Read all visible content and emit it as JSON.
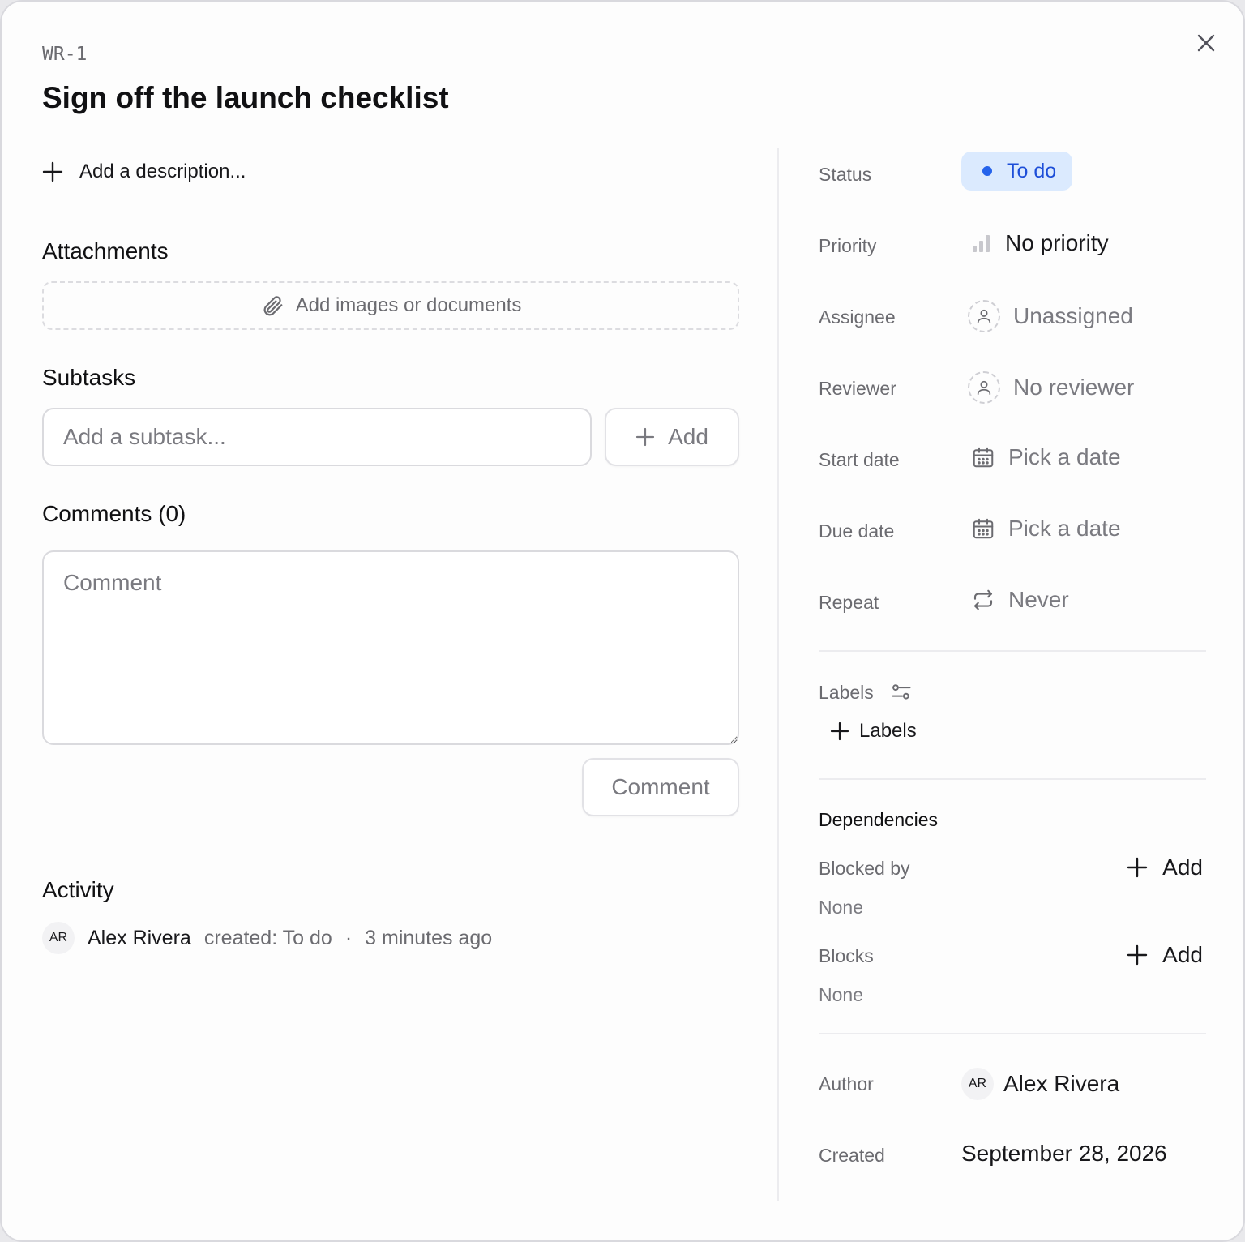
{
  "task": {
    "id": "WR-1",
    "title": "Sign off the launch checklist"
  },
  "description": {
    "add_label": "Add a description..."
  },
  "attachments": {
    "heading": "Attachments",
    "drop_label": "Add images or documents"
  },
  "subtasks": {
    "heading": "Subtasks",
    "input_placeholder": "Add a subtask...",
    "add_label": "Add"
  },
  "comments": {
    "heading": "Comments (0)",
    "placeholder": "Comment",
    "submit_label": "Comment"
  },
  "activity": {
    "heading": "Activity",
    "items": [
      {
        "initials": "AR",
        "user": "Alex Rivera",
        "action": "created: To do",
        "separator": "·",
        "time": "3 minutes ago"
      }
    ]
  },
  "properties": {
    "status": {
      "label": "Status",
      "value": "To do",
      "color": "#2563eb"
    },
    "priority": {
      "label": "Priority",
      "value": "No priority"
    },
    "assignee": {
      "label": "Assignee",
      "value": "Unassigned"
    },
    "reviewer": {
      "label": "Reviewer",
      "value": "No reviewer"
    },
    "start_date": {
      "label": "Start date",
      "value": "Pick a date"
    },
    "due_date": {
      "label": "Due date",
      "value": "Pick a date"
    },
    "repeat": {
      "label": "Repeat",
      "value": "Never"
    }
  },
  "labels": {
    "heading": "Labels",
    "add_label": "Labels"
  },
  "dependencies": {
    "heading": "Dependencies",
    "blocked_by": {
      "label": "Blocked by",
      "add_label": "Add",
      "value": "None"
    },
    "blocks": {
      "label": "Blocks",
      "add_label": "Add",
      "value": "None"
    }
  },
  "meta": {
    "author": {
      "label": "Author",
      "initials": "AR",
      "name": "Alex Rivera"
    },
    "created": {
      "label": "Created",
      "value": "September 28, 2026"
    }
  }
}
